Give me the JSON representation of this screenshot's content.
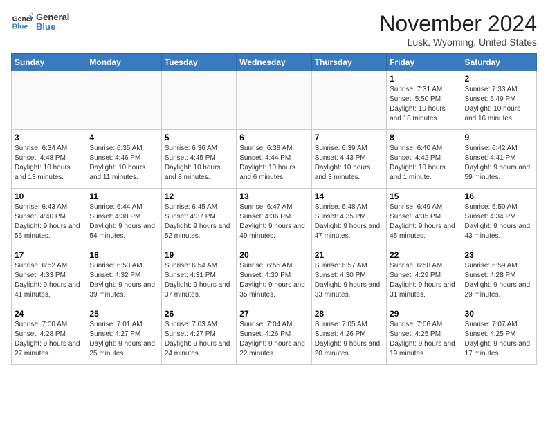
{
  "header": {
    "logo_line1": "General",
    "logo_line2": "Blue",
    "month": "November 2024",
    "location": "Lusk, Wyoming, United States"
  },
  "days_of_week": [
    "Sunday",
    "Monday",
    "Tuesday",
    "Wednesday",
    "Thursday",
    "Friday",
    "Saturday"
  ],
  "weeks": [
    [
      {
        "day": "",
        "info": ""
      },
      {
        "day": "",
        "info": ""
      },
      {
        "day": "",
        "info": ""
      },
      {
        "day": "",
        "info": ""
      },
      {
        "day": "",
        "info": ""
      },
      {
        "day": "1",
        "info": "Sunrise: 7:31 AM\nSunset: 5:50 PM\nDaylight: 10 hours and 18 minutes."
      },
      {
        "day": "2",
        "info": "Sunrise: 7:33 AM\nSunset: 5:49 PM\nDaylight: 10 hours and 16 minutes."
      }
    ],
    [
      {
        "day": "3",
        "info": "Sunrise: 6:34 AM\nSunset: 4:48 PM\nDaylight: 10 hours and 13 minutes."
      },
      {
        "day": "4",
        "info": "Sunrise: 6:35 AM\nSunset: 4:46 PM\nDaylight: 10 hours and 11 minutes."
      },
      {
        "day": "5",
        "info": "Sunrise: 6:36 AM\nSunset: 4:45 PM\nDaylight: 10 hours and 8 minutes."
      },
      {
        "day": "6",
        "info": "Sunrise: 6:38 AM\nSunset: 4:44 PM\nDaylight: 10 hours and 6 minutes."
      },
      {
        "day": "7",
        "info": "Sunrise: 6:39 AM\nSunset: 4:43 PM\nDaylight: 10 hours and 3 minutes."
      },
      {
        "day": "8",
        "info": "Sunrise: 6:40 AM\nSunset: 4:42 PM\nDaylight: 10 hours and 1 minute."
      },
      {
        "day": "9",
        "info": "Sunrise: 6:42 AM\nSunset: 4:41 PM\nDaylight: 9 hours and 59 minutes."
      }
    ],
    [
      {
        "day": "10",
        "info": "Sunrise: 6:43 AM\nSunset: 4:40 PM\nDaylight: 9 hours and 56 minutes."
      },
      {
        "day": "11",
        "info": "Sunrise: 6:44 AM\nSunset: 4:38 PM\nDaylight: 9 hours and 54 minutes."
      },
      {
        "day": "12",
        "info": "Sunrise: 6:45 AM\nSunset: 4:37 PM\nDaylight: 9 hours and 52 minutes."
      },
      {
        "day": "13",
        "info": "Sunrise: 6:47 AM\nSunset: 4:36 PM\nDaylight: 9 hours and 49 minutes."
      },
      {
        "day": "14",
        "info": "Sunrise: 6:48 AM\nSunset: 4:35 PM\nDaylight: 9 hours and 47 minutes."
      },
      {
        "day": "15",
        "info": "Sunrise: 6:49 AM\nSunset: 4:35 PM\nDaylight: 9 hours and 45 minutes."
      },
      {
        "day": "16",
        "info": "Sunrise: 6:50 AM\nSunset: 4:34 PM\nDaylight: 9 hours and 43 minutes."
      }
    ],
    [
      {
        "day": "17",
        "info": "Sunrise: 6:52 AM\nSunset: 4:33 PM\nDaylight: 9 hours and 41 minutes."
      },
      {
        "day": "18",
        "info": "Sunrise: 6:53 AM\nSunset: 4:32 PM\nDaylight: 9 hours and 39 minutes."
      },
      {
        "day": "19",
        "info": "Sunrise: 6:54 AM\nSunset: 4:31 PM\nDaylight: 9 hours and 37 minutes."
      },
      {
        "day": "20",
        "info": "Sunrise: 6:55 AM\nSunset: 4:30 PM\nDaylight: 9 hours and 35 minutes."
      },
      {
        "day": "21",
        "info": "Sunrise: 6:57 AM\nSunset: 4:30 PM\nDaylight: 9 hours and 33 minutes."
      },
      {
        "day": "22",
        "info": "Sunrise: 6:58 AM\nSunset: 4:29 PM\nDaylight: 9 hours and 31 minutes."
      },
      {
        "day": "23",
        "info": "Sunrise: 6:59 AM\nSunset: 4:28 PM\nDaylight: 9 hours and 29 minutes."
      }
    ],
    [
      {
        "day": "24",
        "info": "Sunrise: 7:00 AM\nSunset: 4:28 PM\nDaylight: 9 hours and 27 minutes."
      },
      {
        "day": "25",
        "info": "Sunrise: 7:01 AM\nSunset: 4:27 PM\nDaylight: 9 hours and 25 minutes."
      },
      {
        "day": "26",
        "info": "Sunrise: 7:03 AM\nSunset: 4:27 PM\nDaylight: 9 hours and 24 minutes."
      },
      {
        "day": "27",
        "info": "Sunrise: 7:04 AM\nSunset: 4:26 PM\nDaylight: 9 hours and 22 minutes."
      },
      {
        "day": "28",
        "info": "Sunrise: 7:05 AM\nSunset: 4:26 PM\nDaylight: 9 hours and 20 minutes."
      },
      {
        "day": "29",
        "info": "Sunrise: 7:06 AM\nSunset: 4:25 PM\nDaylight: 9 hours and 19 minutes."
      },
      {
        "day": "30",
        "info": "Sunrise: 7:07 AM\nSunset: 4:25 PM\nDaylight: 9 hours and 17 minutes."
      }
    ]
  ]
}
